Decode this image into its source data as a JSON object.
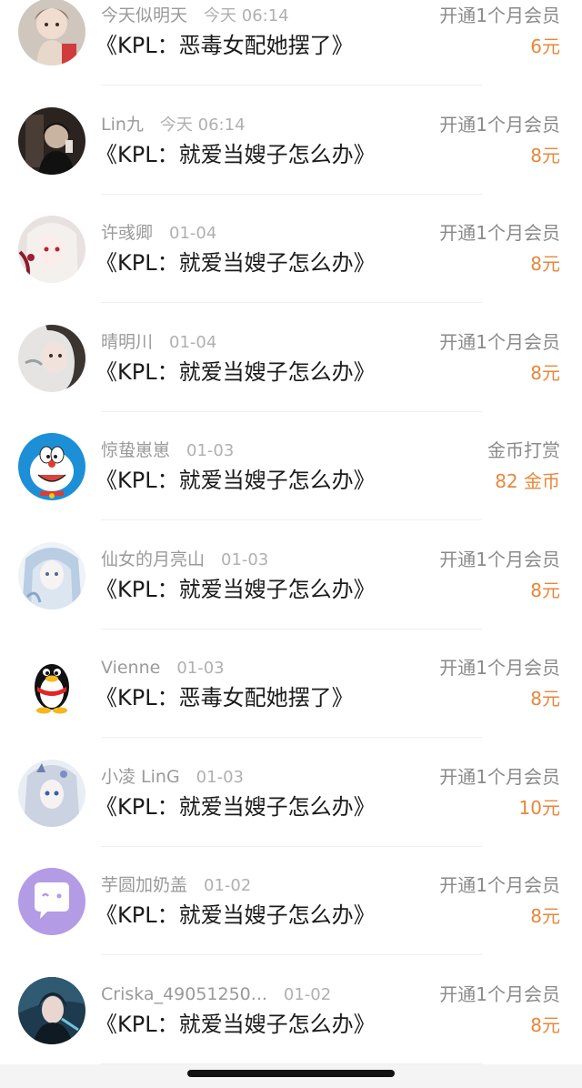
{
  "orders": [
    {
      "user": "今天似明天",
      "time": "今天 06:14",
      "title": "《KPL：恶毒女配她摆了》",
      "type": "开通1个月会员",
      "price": "6元",
      "avatar": "figurine-avatar"
    },
    {
      "user": "Lin九",
      "time": "今天 06:14",
      "title": "《KPL：就爱当嫂子怎么办》",
      "type": "开通1个月会员",
      "price": "8元",
      "avatar": "dark-photo-avatar"
    },
    {
      "user": "许彧卿",
      "time": "01-04",
      "title": "《KPL：就爱当嫂子怎么办》",
      "type": "开通1个月会员",
      "price": "8元",
      "avatar": "anime-red-avatar"
    },
    {
      "user": "晴明川",
      "time": "01-04",
      "title": "《KPL：就爱当嫂子怎么办》",
      "type": "开通1个月会员",
      "price": "8元",
      "avatar": "portrait-avatar"
    },
    {
      "user": "惊蛰崽崽",
      "time": "01-03",
      "title": "《KPL：就爱当嫂子怎么办》",
      "type": "金币打赏",
      "price": "82 金币",
      "avatar": "doraemon-avatar"
    },
    {
      "user": "仙女的月亮山",
      "time": "01-03",
      "title": "《KPL：就爱当嫂子怎么办》",
      "type": "开通1个月会员",
      "price": "8元",
      "avatar": "anime-blue-avatar"
    },
    {
      "user": "Vienne",
      "time": "01-03",
      "title": "《KPL：恶毒女配她摆了》",
      "type": "开通1个月会员",
      "price": "8元",
      "avatar": "penguin-avatar"
    },
    {
      "user": "小凌 LinG",
      "time": "01-03",
      "title": "《KPL：就爱当嫂子怎么办》",
      "type": "开通1个月会员",
      "price": "10元",
      "avatar": "anime-silver-avatar"
    },
    {
      "user": "芋圆加奶盖",
      "time": "01-02",
      "title": "《KPL：就爱当嫂子怎么办》",
      "type": "开通1个月会员",
      "price": "8元",
      "avatar": "chat-bubble-avatar"
    },
    {
      "user": "Criska_49051250...",
      "time": "01-02",
      "title": "《KPL：就爱当嫂子怎么办》",
      "type": "开通1个月会员",
      "price": "8元",
      "avatar": "game-character-avatar"
    }
  ]
}
